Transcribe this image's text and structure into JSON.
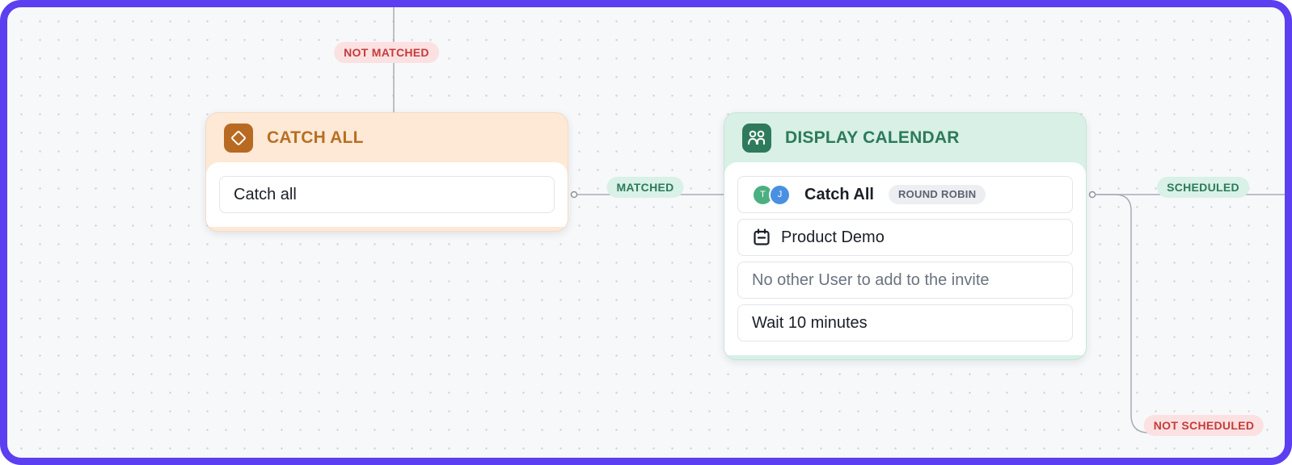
{
  "edges": {
    "not_matched": "NOT MATCHED",
    "matched": "MATCHED",
    "scheduled": "SCHEDULED",
    "not_scheduled": "NOT SCHEDULED"
  },
  "catch_all_node": {
    "title": "CATCH ALL",
    "icon": "diamond-icon",
    "rows": [
      "Catch all"
    ]
  },
  "display_calendar_node": {
    "title": "DISPLAY CALENDAR",
    "icon": "users-icon",
    "assignment": {
      "avatars": [
        {
          "initial": "T",
          "color": "#4caf82"
        },
        {
          "initial": "J",
          "color": "#4a90e2"
        }
      ],
      "name": "Catch All",
      "badge": "ROUND ROBIN"
    },
    "event_type": {
      "icon": "calendar-icon",
      "label": "Product Demo"
    },
    "invite": "No other User to add to the invite",
    "wait": "Wait 10 minutes"
  },
  "colors": {
    "frame": "#5b3ff0",
    "catch_accent": "#b96a22",
    "display_accent": "#2f7a5c",
    "negative": "#c53b3b",
    "positive": "#2c7a5b"
  }
}
